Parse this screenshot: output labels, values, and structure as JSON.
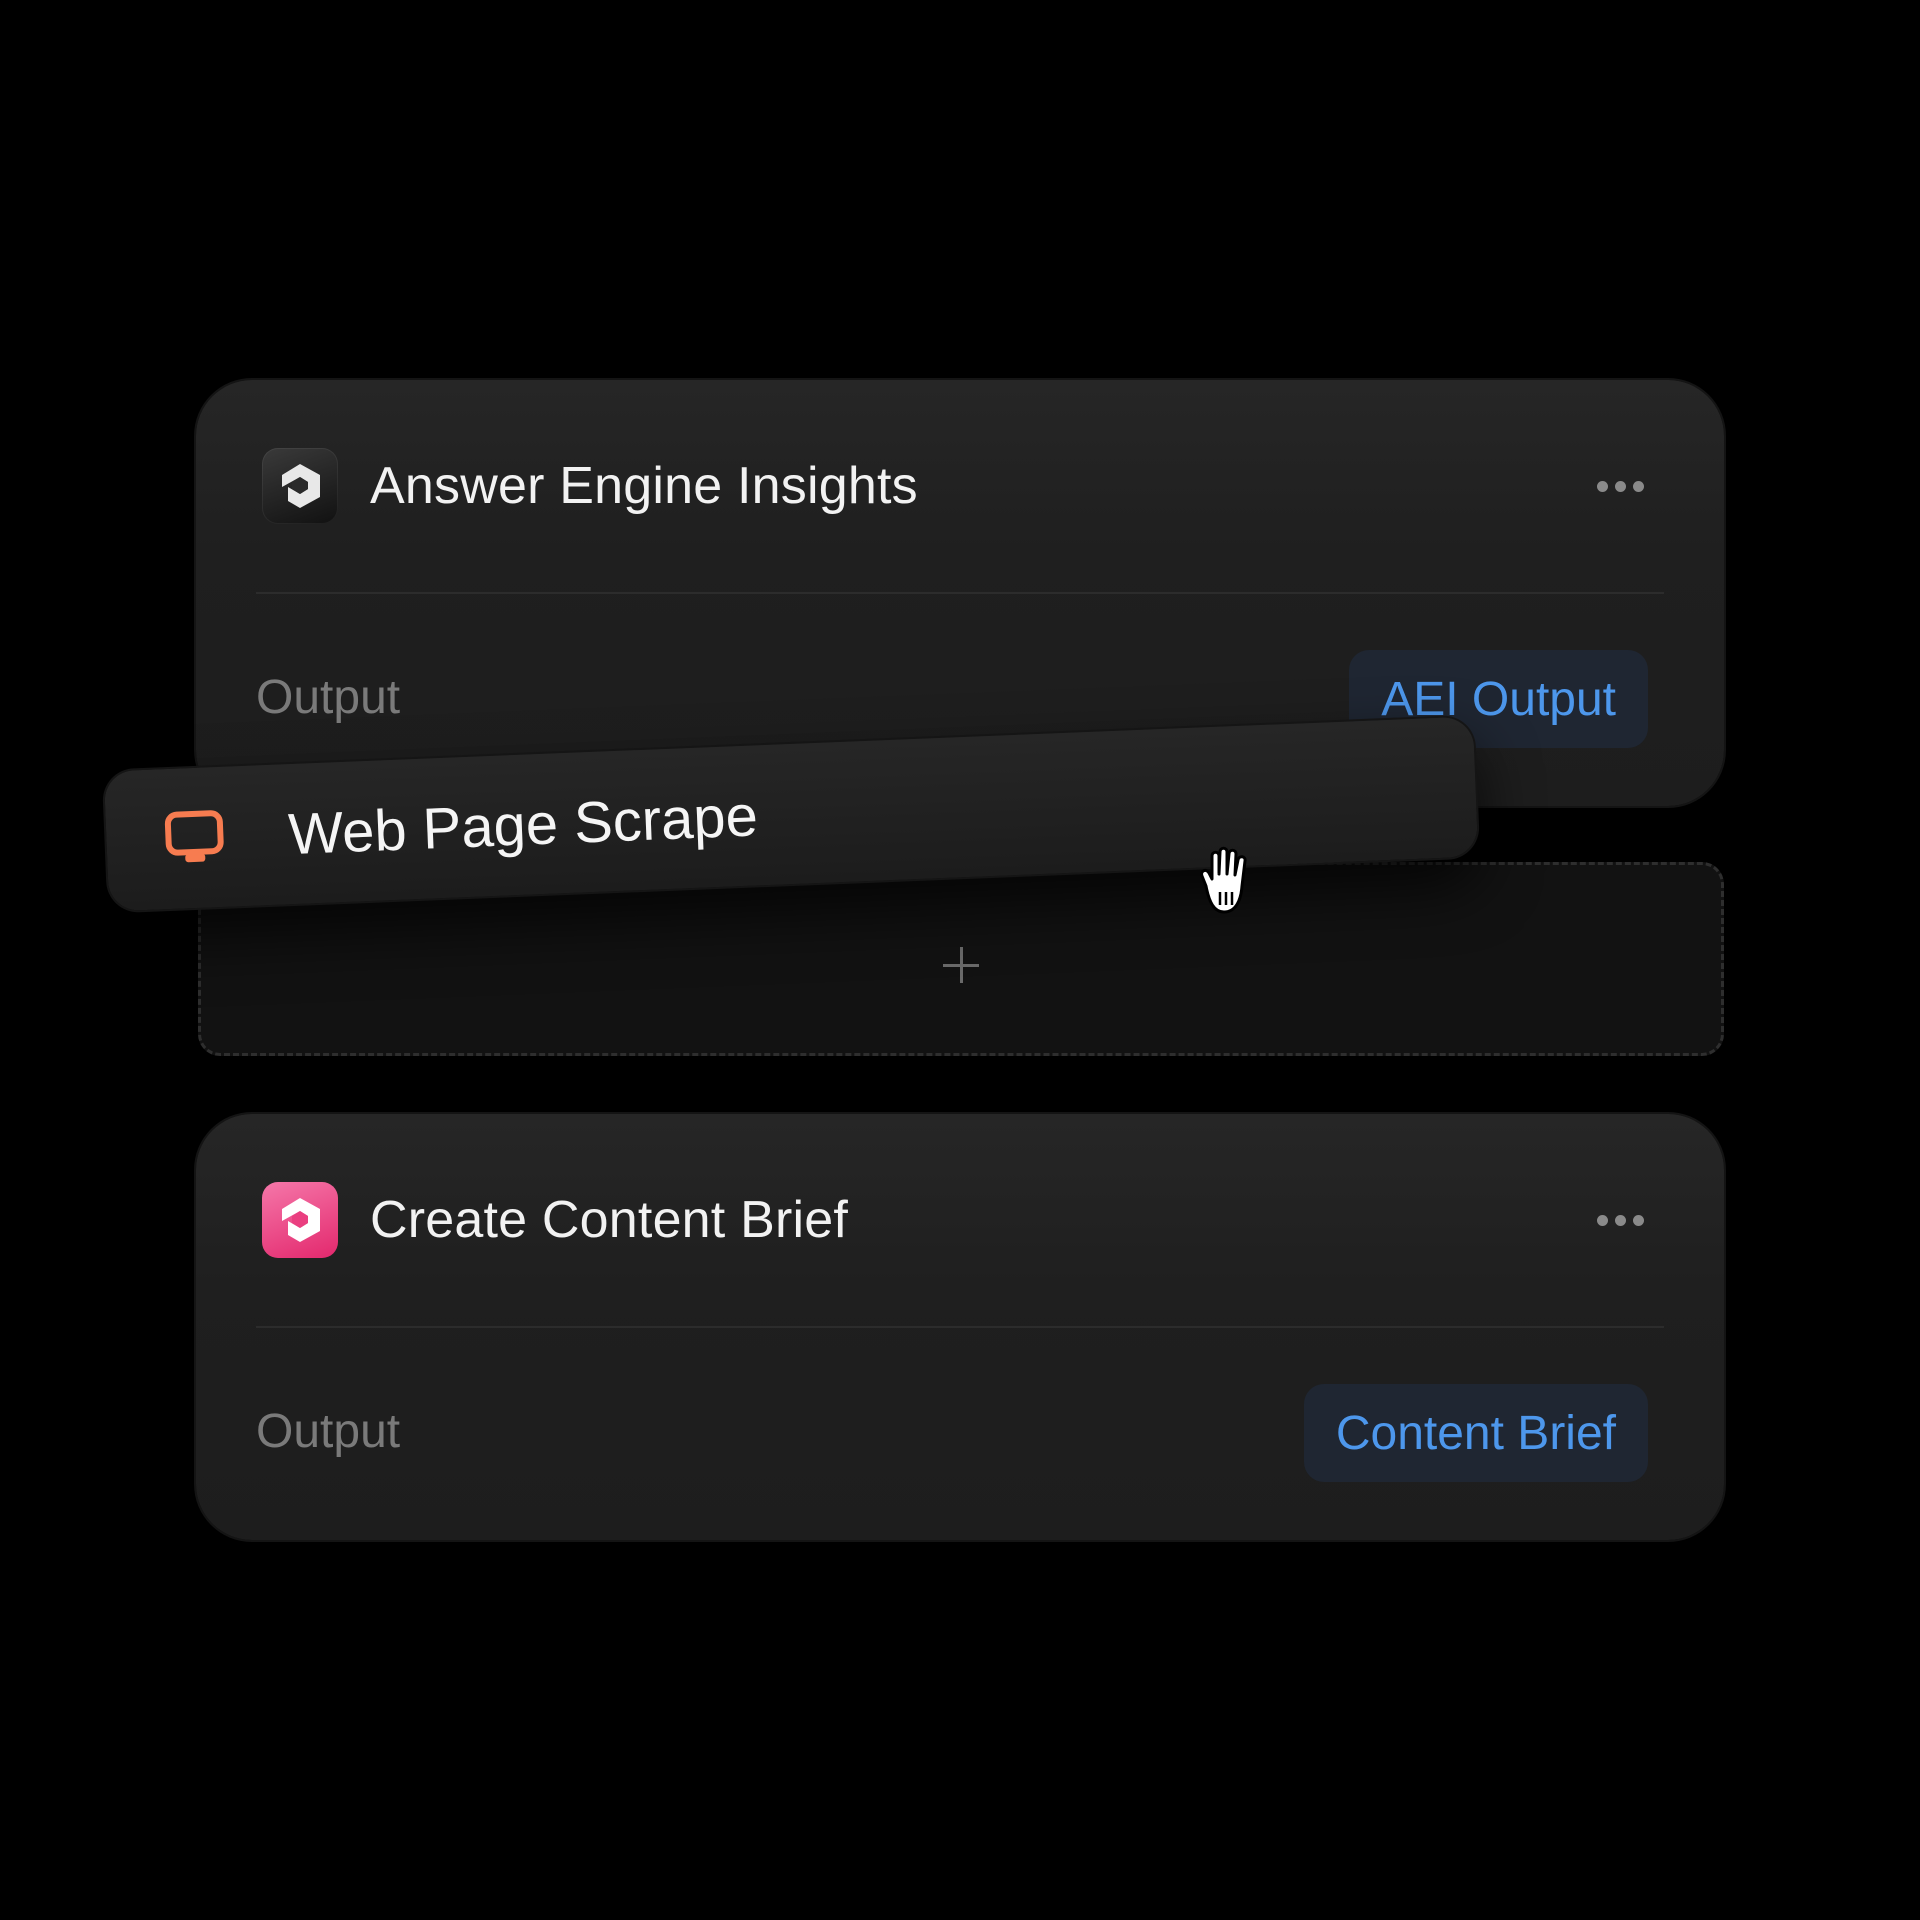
{
  "steps": [
    {
      "title": "Answer Engine Insights",
      "icon": "answer-engine-app-icon",
      "output_label": "Output",
      "output_value": "AEI Output"
    },
    {
      "title": "Create Content Brief",
      "icon": "content-brief-app-icon",
      "output_label": "Output",
      "output_value": "Content Brief"
    }
  ],
  "dragged_item": {
    "title": "Web Page Scrape",
    "icon": "monitor-icon"
  },
  "drop_zone": {
    "icon": "plus-icon"
  },
  "cursor": "grab-hand-cursor",
  "colors": {
    "background": "#000000",
    "card": "#1f1f1f",
    "chip_text": "#4d97ec",
    "chip_bg": "#1f2632",
    "monitor_icon": "#f77c50",
    "pink_icon": "#e8347a",
    "muted_text": "#7a7a7a"
  }
}
